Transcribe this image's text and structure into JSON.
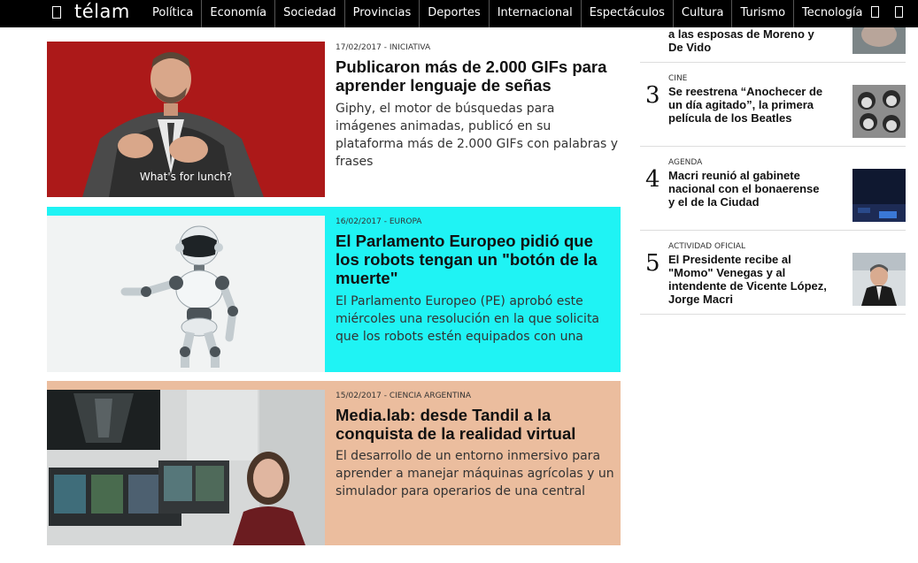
{
  "nav": {
    "logo": "télam",
    "items": [
      "Política",
      "Economía",
      "Sociedad",
      "Provincias",
      "Deportes",
      "Internacional",
      "Espectáculos",
      "Cultura",
      "Turismo",
      "Tecnología"
    ]
  },
  "articles": [
    {
      "meta": "17/02/2017 - INICIATIVA",
      "headline": "Publicaron más de 2.000 GIFs para aprender lenguaje de señas",
      "summary": "Giphy, el motor de búsquedas para imágenes animadas, publicó en su plataforma más de 2.000 GIFs con palabras y frases",
      "caption": "What's for lunch?"
    },
    {
      "meta": "16/02/2017 - EUROPA",
      "headline": "El Parlamento Europeo pidió que los robots tengan un \"botón de la muerte\"",
      "summary": "El Parlamento Europeo (PE) aprobó este miércoles una resolución en la que solicita que los robots estén equipados con una"
    },
    {
      "meta": "15/02/2017 - CIENCIA ARGENTINA",
      "headline": "Media.lab: desde Tandil a la conquista de la realidad virtual",
      "summary": "El desarrollo de un entorno inmersivo para aprender a manejar máquinas agrícolas y un simulador para operarios de una central"
    }
  ],
  "sidebar": [
    {
      "num": "",
      "category": "",
      "title": "a las esposas de Moreno y De Vido"
    },
    {
      "num": "3",
      "category": "CINE",
      "title": "Se reestrena “Anochecer de un día agitado”, la primera película de los Beatles"
    },
    {
      "num": "4",
      "category": "AGENDA",
      "title": "Macri reunió al gabinete nacional con el bonaerense y el de la Ciudad"
    },
    {
      "num": "5",
      "category": "ACTIVIDAD OFICIAL",
      "title": "El Presidente recibe al \"Momo\" Venegas y al intendente de Vicente López, Jorge Macri"
    }
  ]
}
